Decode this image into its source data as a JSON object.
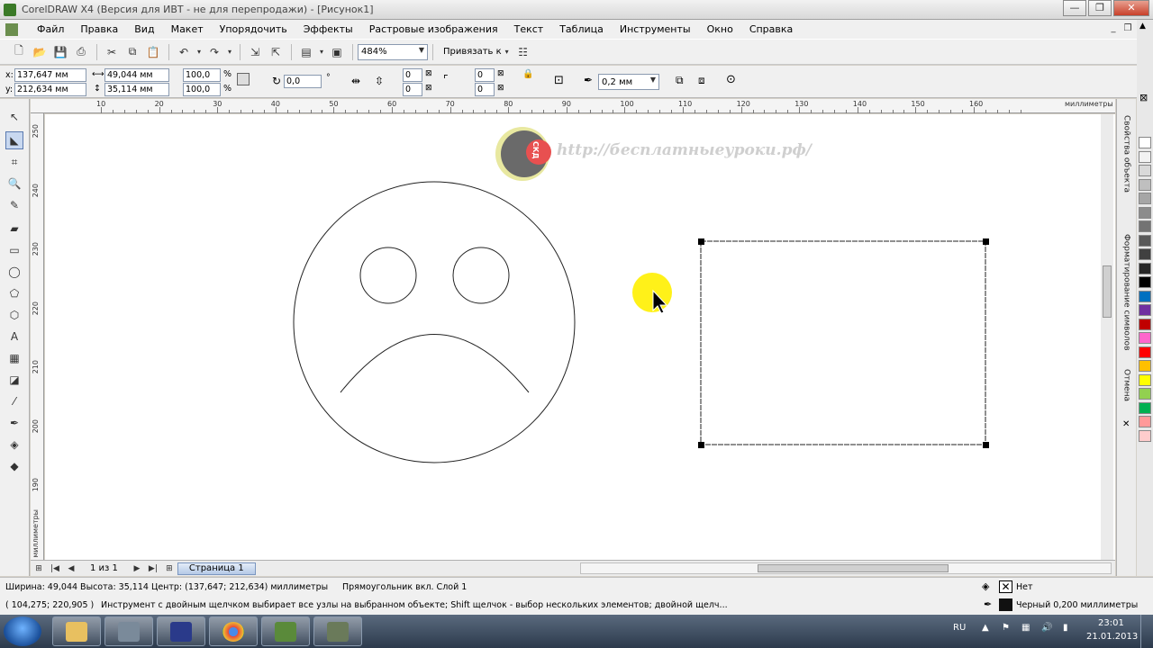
{
  "window": {
    "title": "CorelDRAW X4 (Версия для ИВТ - не для перепродажи) - [Рисунок1]"
  },
  "menu": [
    "Файл",
    "Правка",
    "Вид",
    "Макет",
    "Упорядочить",
    "Эффекты",
    "Растровые изображения",
    "Текст",
    "Таблица",
    "Инструменты",
    "Окно",
    "Справка"
  ],
  "toolbar": {
    "zoom": "484%",
    "snap_label": "Привязать к"
  },
  "property_bar": {
    "x_label": "x:",
    "x_value": "137,647 мм",
    "y_label": "y:",
    "y_value": "212,634 мм",
    "width_value": "49,044 мм",
    "height_value": "35,114 мм",
    "scale_x": "100,0",
    "scale_y": "100,0",
    "percent": "%",
    "rotation": "0,0",
    "degree": "°",
    "corner_tl": "0",
    "corner_bl": "0",
    "corner_tr": "0",
    "corner_br": "0",
    "outline_width": "0,2 мм"
  },
  "ruler": {
    "top_labels": [
      "10",
      "20",
      "30",
      "40",
      "50",
      "60",
      "70",
      "80",
      "90",
      "100",
      "110",
      "120",
      "130",
      "140",
      "150",
      "160"
    ],
    "top_unit": "миллиметры",
    "left_labels": [
      "250",
      "240",
      "230",
      "220",
      "210",
      "200",
      "190"
    ],
    "left_unit": "миллиметры"
  },
  "canvas": {
    "watermark": "http://бесплатныеуроки.рф/",
    "logo_text": "СКД"
  },
  "dockers": {
    "tab1": "Свойства объекта",
    "tab2": "Форматирование символов",
    "tab3": "Отмена"
  },
  "navigator": {
    "page_count": "1 из 1",
    "page_tab": "Страница 1"
  },
  "status": {
    "dimensions": "Ширина: 49,044  Высота: 35,114  Центр: (137,647; 212,634)  миллиметры",
    "selection": "Прямоугольник вкл. Слой 1",
    "cursor": "( 104,275; 220,905 )",
    "hint": "Инструмент с двойным щелчком выбирает все узлы на выбранном объекте; Shift щелчок - выбор нескольких элементов; двойной щелч...",
    "fill_label": "Нет",
    "outline_label": "Черный  0,200 миллиметры"
  },
  "taskbar": {
    "lang": "RU",
    "time": "23:01",
    "date": "21.01.2013"
  },
  "palette_colors": [
    "#ffffff",
    "#f2f2f2",
    "#d9d9d9",
    "#bfbfbf",
    "#a6a6a6",
    "#8c8c8c",
    "#737373",
    "#595959",
    "#404040",
    "#262626",
    "#000000",
    "#0070c0",
    "#7030a0",
    "#c00000",
    "#ff66cc",
    "#ff0000",
    "#ffc000",
    "#ffff00",
    "#92d050",
    "#00b050",
    "#ff9999",
    "#ffcccc"
  ]
}
